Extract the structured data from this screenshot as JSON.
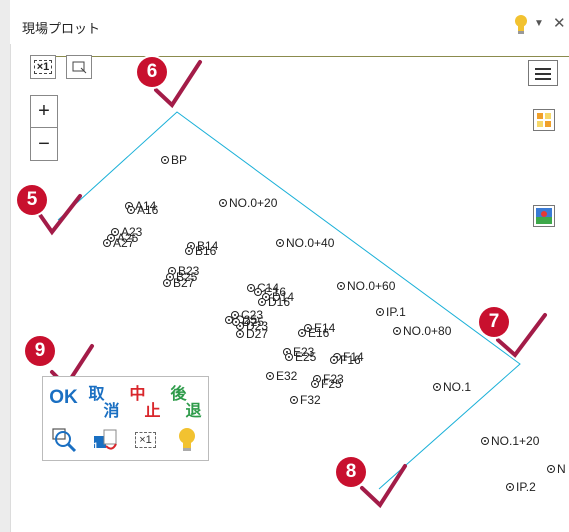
{
  "window": {
    "title": "現場プロット",
    "dropdown_glyph": "▼",
    "close_glyph": "✕"
  },
  "toolbar": {
    "fit_label": "×1",
    "zoom_in": "+",
    "zoom_out": "−"
  },
  "map": {
    "line_color": "#1ab0d8",
    "points": [
      {
        "label": "BP"
      },
      {
        "label": "A14"
      },
      {
        "label": "A16"
      },
      {
        "label": "NO.0+20"
      },
      {
        "label": "A23"
      },
      {
        "label": "A25"
      },
      {
        "label": "A27"
      },
      {
        "label": "B14"
      },
      {
        "label": "B16"
      },
      {
        "label": "NO.0+40"
      },
      {
        "label": "B23"
      },
      {
        "label": "B25"
      },
      {
        "label": "B27"
      },
      {
        "label": "C14"
      },
      {
        "label": "C16"
      },
      {
        "label": "D14"
      },
      {
        "label": "D16"
      },
      {
        "label": "NO.0+60"
      },
      {
        "label": "C23"
      },
      {
        "label": "C25"
      },
      {
        "label": "D23"
      },
      {
        "label": "D25"
      },
      {
        "label": "D27"
      },
      {
        "label": "IP.1"
      },
      {
        "label": "E14"
      },
      {
        "label": "E16"
      },
      {
        "label": "NO.0+80"
      },
      {
        "label": "E23"
      },
      {
        "label": "E25"
      },
      {
        "label": "F14"
      },
      {
        "label": "F16"
      },
      {
        "label": "E32"
      },
      {
        "label": "F23"
      },
      {
        "label": "F25"
      },
      {
        "label": "NO.1"
      },
      {
        "label": "F32"
      },
      {
        "label": "NO.1+20"
      },
      {
        "label": "N"
      },
      {
        "label": "IP.2"
      }
    ]
  },
  "callouts": [
    "5",
    "6",
    "7",
    "8",
    "9"
  ],
  "callout_color": "#c8102e",
  "checkmark_color": "#a31c48",
  "panel": {
    "ok": "OK",
    "cancel": [
      "取",
      "消"
    ],
    "stop": [
      "中",
      "止"
    ],
    "back": [
      "後",
      "退"
    ],
    "stop_color": "#d9262b",
    "back_color": "#2e9b4a",
    "cancel_color": "#1a6fc2",
    "fit_label": "×1",
    "layer_number": "1"
  }
}
